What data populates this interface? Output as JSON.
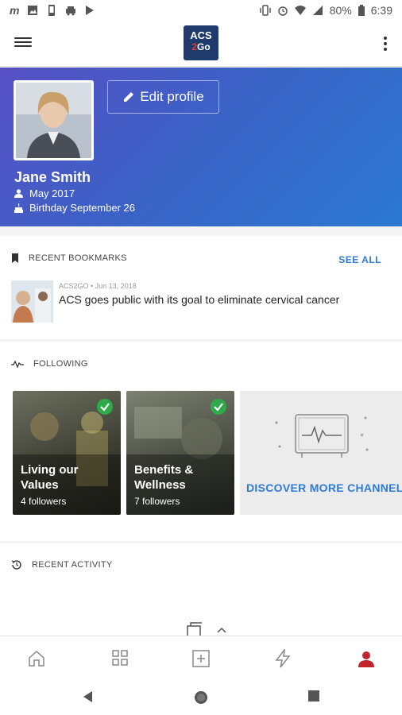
{
  "statusbar": {
    "icons_left": [
      "gmail-icon",
      "photos-icon",
      "phone-icon",
      "car-icon",
      "play-icon"
    ],
    "battery": "80%",
    "time": "6:39"
  },
  "appbar": {
    "logo_top": "ACS",
    "logo_bottom": "Go",
    "logo_bottom_accent": "2"
  },
  "profile": {
    "edit_label": "Edit profile",
    "name": "Jane Smith",
    "joined": "May 2017",
    "birthday": "Birthday September 26"
  },
  "bookmarks": {
    "heading": "RECENT BOOKMARKS",
    "see_all": "SEE ALL",
    "items": [
      {
        "source": "ACS2GO • Jun 13, 2018",
        "title": "ACS goes public with its goal to eliminate cervical cancer"
      }
    ]
  },
  "following": {
    "heading": "FOLLOWING",
    "channels": [
      {
        "title": "Living our Values",
        "followers": "4 followers"
      },
      {
        "title": "Benefits & Wellness",
        "followers": "7 followers"
      }
    ],
    "discover_label": "DISCOVER MORE CHANNELS"
  },
  "activity": {
    "heading": "RECENT ACTIVITY"
  },
  "colors": {
    "accent": "#2f7bd8",
    "active_nav": "#c0262c",
    "check": "#2eaa4a"
  }
}
